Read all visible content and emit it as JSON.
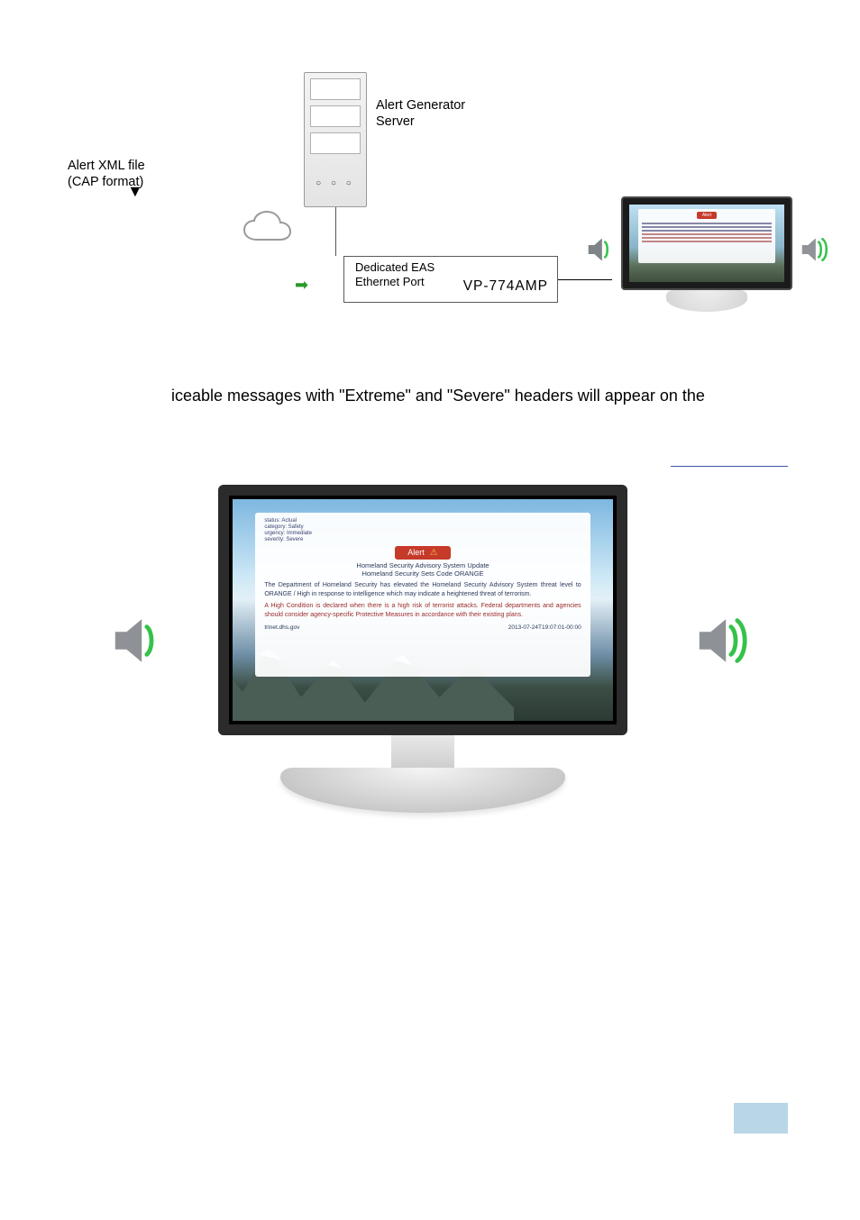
{
  "figure1": {
    "server_label": "Alert Generator\nServer",
    "xml_label_line1": "Alert XML file",
    "xml_label_line2": "(CAP format)",
    "dedicated_port_line1": "Dedicated EAS",
    "dedicated_port_line2": "Ethernet Port",
    "device_model": "VP-774AMP",
    "mini_alert_badge": "Alert"
  },
  "paragraph1_fragment": "iceable messages with \"Extreme\" and \"Severe\" headers will appear on the",
  "figure2": {
    "alert": {
      "meta_line1": "status: Actual",
      "meta_line2": "category: Safety",
      "meta_line3": "urgency: Immediate",
      "meta_line4": "severity: Severe",
      "badge": "Alert",
      "headline_line1": "Homeland Security Advisory System Update",
      "headline_line2": "Homeland Security Sets Code ORANGE",
      "body1": "The Department of Homeland Security has elevated the Homeland Security Advisory System threat level to ORANGE / High in response to intelligence which may indicate a heightened threat of terrorism.",
      "body2": "A High Condition is declared when there is a high risk of terrorist attacks. Federal departments and agencies should consider agency-specific Protective Measures in accordance with their existing plans.",
      "footer_left": "trinet.dhs.gov",
      "footer_right": "2013-07-24T19:07:01-00:00"
    }
  }
}
